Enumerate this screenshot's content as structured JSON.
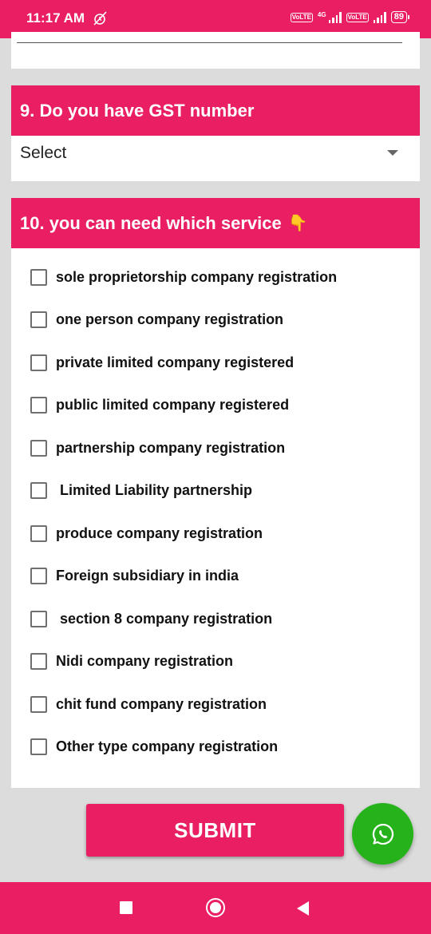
{
  "status_bar": {
    "time": "11:17 AM",
    "network": "4G",
    "volte_label": "Vo LTE",
    "battery": "89",
    "icons": [
      "alarm-off-icon",
      "volte-icon",
      "signal-icon",
      "battery-icon"
    ]
  },
  "question9": {
    "title": "9. Do you have GST number",
    "select_value": "Select"
  },
  "question10": {
    "title": "10. you can need which service",
    "emoji": "👇",
    "options": [
      "sole proprietorship company registration",
      "one person company registration",
      "private limited company registered",
      "public limited company registered",
      "partnership company registration",
      " Limited Liability partnership",
      "produce company registration",
      "Foreign subsidiary in india",
      " section 8 company registration",
      "Nidi company registration",
      "chit fund company registration",
      "Other type company registration"
    ]
  },
  "submit_label": "SUBMIT",
  "colors": {
    "accent": "#e91e63",
    "whatsapp": "#25b21a",
    "background": "#dcdcdc"
  }
}
